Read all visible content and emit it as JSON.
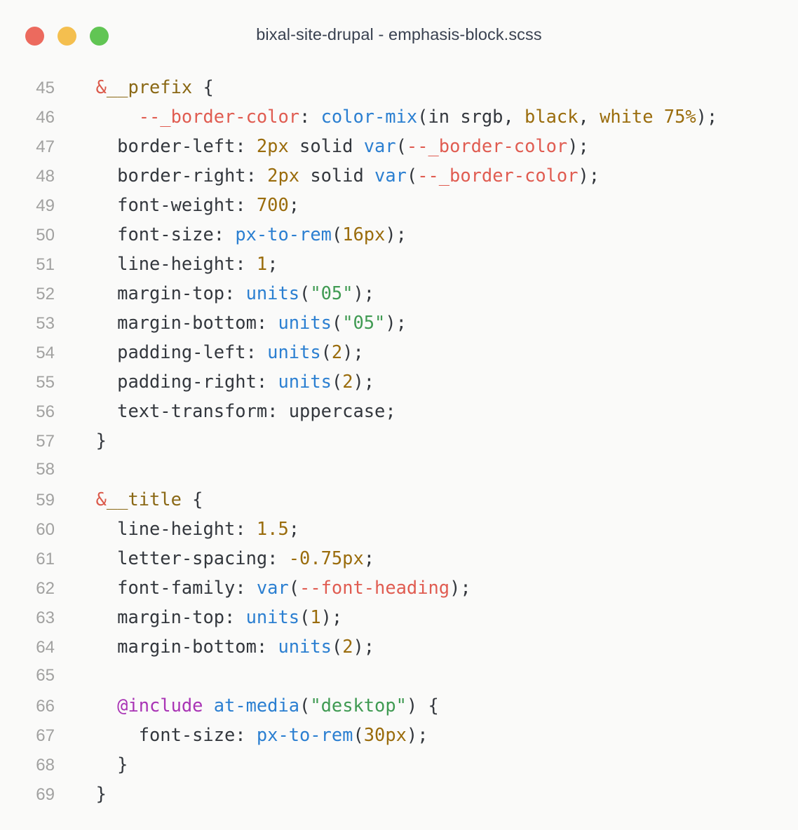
{
  "window": {
    "title": "bixal-site-drupal - emphasis-block.scss",
    "traffic_lights": [
      {
        "name": "close-button",
        "label": "Close",
        "color": "#ec6a5e"
      },
      {
        "name": "minimize-button",
        "label": "Minimize",
        "color": "#f4bf4f"
      },
      {
        "name": "maximize-button",
        "label": "Maximize",
        "color": "#61c554"
      }
    ],
    "background": "#fafaf9"
  },
  "editor": {
    "language": "scss",
    "first_line_number": 45,
    "last_line_number": 69,
    "theme_colors": {
      "background": "#fafaf9",
      "line_number": "#a1a1a0",
      "text": "#33373d",
      "selector": "#8a6815",
      "ampersand": "#db5a4b",
      "css_variable": "#e05c51",
      "function": "#2b7fd1",
      "number": "#9a6c0c",
      "string": "#3f9a52",
      "at_rule": "#a934b5"
    },
    "lines": [
      {
        "n": "45",
        "tokens": [
          {
            "t": "  ",
            "c": "t-plain"
          },
          {
            "t": "&",
            "c": "t-amp"
          },
          {
            "t": "__prefix",
            "c": "t-sel"
          },
          {
            "t": " {",
            "c": "t-punct"
          }
        ]
      },
      {
        "n": "46",
        "tokens": [
          {
            "t": "      ",
            "c": "t-plain"
          },
          {
            "t": "--_border-color",
            "c": "t-cssvar"
          },
          {
            "t": ": ",
            "c": "t-punct"
          },
          {
            "t": "color-mix",
            "c": "t-func"
          },
          {
            "t": "(in srgb, ",
            "c": "t-punct"
          },
          {
            "t": "black",
            "c": "t-num"
          },
          {
            "t": ", ",
            "c": "t-punct"
          },
          {
            "t": "white 75%",
            "c": "t-num"
          },
          {
            "t": ");",
            "c": "t-punct"
          }
        ]
      },
      {
        "n": "47",
        "tokens": [
          {
            "t": "    ",
            "c": "t-plain"
          },
          {
            "t": "border-left",
            "c": "t-prop"
          },
          {
            "t": ": ",
            "c": "t-punct"
          },
          {
            "t": "2px",
            "c": "t-num"
          },
          {
            "t": " solid ",
            "c": "t-plain"
          },
          {
            "t": "var",
            "c": "t-func"
          },
          {
            "t": "(",
            "c": "t-punct"
          },
          {
            "t": "--_border-color",
            "c": "t-cssvar"
          },
          {
            "t": ");",
            "c": "t-punct"
          }
        ]
      },
      {
        "n": "48",
        "tokens": [
          {
            "t": "    ",
            "c": "t-plain"
          },
          {
            "t": "border-right",
            "c": "t-prop"
          },
          {
            "t": ": ",
            "c": "t-punct"
          },
          {
            "t": "2px",
            "c": "t-num"
          },
          {
            "t": " solid ",
            "c": "t-plain"
          },
          {
            "t": "var",
            "c": "t-func"
          },
          {
            "t": "(",
            "c": "t-punct"
          },
          {
            "t": "--_border-color",
            "c": "t-cssvar"
          },
          {
            "t": ");",
            "c": "t-punct"
          }
        ]
      },
      {
        "n": "49",
        "tokens": [
          {
            "t": "    ",
            "c": "t-plain"
          },
          {
            "t": "font-weight",
            "c": "t-prop"
          },
          {
            "t": ": ",
            "c": "t-punct"
          },
          {
            "t": "700",
            "c": "t-num"
          },
          {
            "t": ";",
            "c": "t-punct"
          }
        ]
      },
      {
        "n": "50",
        "tokens": [
          {
            "t": "    ",
            "c": "t-plain"
          },
          {
            "t": "font-size",
            "c": "t-prop"
          },
          {
            "t": ": ",
            "c": "t-punct"
          },
          {
            "t": "px-to-rem",
            "c": "t-func"
          },
          {
            "t": "(",
            "c": "t-punct"
          },
          {
            "t": "16px",
            "c": "t-num"
          },
          {
            "t": ");",
            "c": "t-punct"
          }
        ]
      },
      {
        "n": "51",
        "tokens": [
          {
            "t": "    ",
            "c": "t-plain"
          },
          {
            "t": "line-height",
            "c": "t-prop"
          },
          {
            "t": ": ",
            "c": "t-punct"
          },
          {
            "t": "1",
            "c": "t-num"
          },
          {
            "t": ";",
            "c": "t-punct"
          }
        ]
      },
      {
        "n": "52",
        "tokens": [
          {
            "t": "    ",
            "c": "t-plain"
          },
          {
            "t": "margin-top",
            "c": "t-prop"
          },
          {
            "t": ": ",
            "c": "t-punct"
          },
          {
            "t": "units",
            "c": "t-func"
          },
          {
            "t": "(",
            "c": "t-punct"
          },
          {
            "t": "\"05\"",
            "c": "t-string"
          },
          {
            "t": ");",
            "c": "t-punct"
          }
        ]
      },
      {
        "n": "53",
        "tokens": [
          {
            "t": "    ",
            "c": "t-plain"
          },
          {
            "t": "margin-bottom",
            "c": "t-prop"
          },
          {
            "t": ": ",
            "c": "t-punct"
          },
          {
            "t": "units",
            "c": "t-func"
          },
          {
            "t": "(",
            "c": "t-punct"
          },
          {
            "t": "\"05\"",
            "c": "t-string"
          },
          {
            "t": ");",
            "c": "t-punct"
          }
        ]
      },
      {
        "n": "54",
        "tokens": [
          {
            "t": "    ",
            "c": "t-plain"
          },
          {
            "t": "padding-left",
            "c": "t-prop"
          },
          {
            "t": ": ",
            "c": "t-punct"
          },
          {
            "t": "units",
            "c": "t-func"
          },
          {
            "t": "(",
            "c": "t-punct"
          },
          {
            "t": "2",
            "c": "t-num"
          },
          {
            "t": ");",
            "c": "t-punct"
          }
        ]
      },
      {
        "n": "55",
        "tokens": [
          {
            "t": "    ",
            "c": "t-plain"
          },
          {
            "t": "padding-right",
            "c": "t-prop"
          },
          {
            "t": ": ",
            "c": "t-punct"
          },
          {
            "t": "units",
            "c": "t-func"
          },
          {
            "t": "(",
            "c": "t-punct"
          },
          {
            "t": "2",
            "c": "t-num"
          },
          {
            "t": ");",
            "c": "t-punct"
          }
        ]
      },
      {
        "n": "56",
        "tokens": [
          {
            "t": "    ",
            "c": "t-plain"
          },
          {
            "t": "text-transform",
            "c": "t-prop"
          },
          {
            "t": ": uppercase;",
            "c": "t-plain"
          }
        ]
      },
      {
        "n": "57",
        "tokens": [
          {
            "t": "  }",
            "c": "t-punct"
          }
        ]
      },
      {
        "n": "58",
        "tokens": [
          {
            "t": "",
            "c": "t-plain"
          }
        ]
      },
      {
        "n": "59",
        "tokens": [
          {
            "t": "  ",
            "c": "t-plain"
          },
          {
            "t": "&",
            "c": "t-amp"
          },
          {
            "t": "__title",
            "c": "t-sel"
          },
          {
            "t": " {",
            "c": "t-punct"
          }
        ]
      },
      {
        "n": "60",
        "tokens": [
          {
            "t": "    ",
            "c": "t-plain"
          },
          {
            "t": "line-height",
            "c": "t-prop"
          },
          {
            "t": ": ",
            "c": "t-punct"
          },
          {
            "t": "1.5",
            "c": "t-num"
          },
          {
            "t": ";",
            "c": "t-punct"
          }
        ]
      },
      {
        "n": "61",
        "tokens": [
          {
            "t": "    ",
            "c": "t-plain"
          },
          {
            "t": "letter-spacing",
            "c": "t-prop"
          },
          {
            "t": ": ",
            "c": "t-punct"
          },
          {
            "t": "-0.75px",
            "c": "t-num"
          },
          {
            "t": ";",
            "c": "t-punct"
          }
        ]
      },
      {
        "n": "62",
        "tokens": [
          {
            "t": "    ",
            "c": "t-plain"
          },
          {
            "t": "font-family",
            "c": "t-prop"
          },
          {
            "t": ": ",
            "c": "t-punct"
          },
          {
            "t": "var",
            "c": "t-func"
          },
          {
            "t": "(",
            "c": "t-punct"
          },
          {
            "t": "--font-heading",
            "c": "t-cssvar"
          },
          {
            "t": ");",
            "c": "t-punct"
          }
        ]
      },
      {
        "n": "63",
        "tokens": [
          {
            "t": "    ",
            "c": "t-plain"
          },
          {
            "t": "margin-top",
            "c": "t-prop"
          },
          {
            "t": ": ",
            "c": "t-punct"
          },
          {
            "t": "units",
            "c": "t-func"
          },
          {
            "t": "(",
            "c": "t-punct"
          },
          {
            "t": "1",
            "c": "t-num"
          },
          {
            "t": ");",
            "c": "t-punct"
          }
        ]
      },
      {
        "n": "64",
        "tokens": [
          {
            "t": "    ",
            "c": "t-plain"
          },
          {
            "t": "margin-bottom",
            "c": "t-prop"
          },
          {
            "t": ": ",
            "c": "t-punct"
          },
          {
            "t": "units",
            "c": "t-func"
          },
          {
            "t": "(",
            "c": "t-punct"
          },
          {
            "t": "2",
            "c": "t-num"
          },
          {
            "t": ");",
            "c": "t-punct"
          }
        ]
      },
      {
        "n": "65",
        "tokens": [
          {
            "t": "",
            "c": "t-plain"
          }
        ]
      },
      {
        "n": "66",
        "tokens": [
          {
            "t": "    ",
            "c": "t-plain"
          },
          {
            "t": "@include",
            "c": "t-atrule"
          },
          {
            "t": " ",
            "c": "t-plain"
          },
          {
            "t": "at-media",
            "c": "t-func"
          },
          {
            "t": "(",
            "c": "t-punct"
          },
          {
            "t": "\"desktop\"",
            "c": "t-string"
          },
          {
            "t": ") {",
            "c": "t-punct"
          }
        ]
      },
      {
        "n": "67",
        "tokens": [
          {
            "t": "      ",
            "c": "t-plain"
          },
          {
            "t": "font-size",
            "c": "t-prop"
          },
          {
            "t": ": ",
            "c": "t-punct"
          },
          {
            "t": "px-to-rem",
            "c": "t-func"
          },
          {
            "t": "(",
            "c": "t-punct"
          },
          {
            "t": "30px",
            "c": "t-num"
          },
          {
            "t": ");",
            "c": "t-punct"
          }
        ]
      },
      {
        "n": "68",
        "tokens": [
          {
            "t": "    }",
            "c": "t-punct"
          }
        ]
      },
      {
        "n": "69",
        "tokens": [
          {
            "t": "  }",
            "c": "t-punct"
          }
        ]
      }
    ]
  }
}
